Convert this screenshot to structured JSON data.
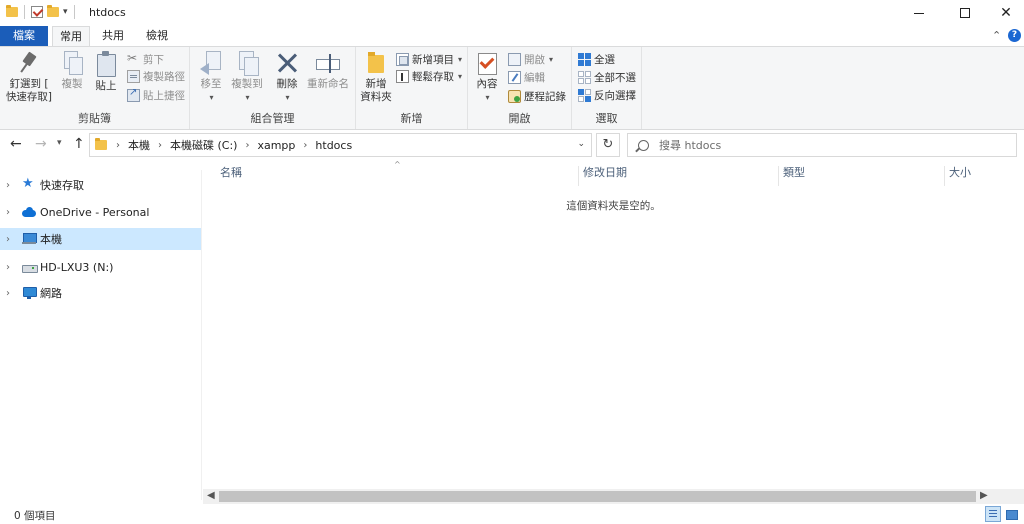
{
  "window": {
    "title": "htdocs"
  },
  "ribbon_tabs": [
    {
      "label": "檔案"
    },
    {
      "label": "常用"
    },
    {
      "label": "共用"
    },
    {
      "label": "檢視"
    }
  ],
  "ribbon": {
    "clipboard": {
      "group_label": "剪貼簿",
      "pin_quick_access_line1": "釘選到 [",
      "pin_quick_access_line2": "快速存取]",
      "copy": "複製",
      "paste": "貼上",
      "cut": "剪下",
      "copy_path": "複製路徑",
      "paste_shortcut": "貼上捷徑"
    },
    "organize": {
      "group_label": "組合管理",
      "move_to": "移至",
      "copy_to": "複製到",
      "delete": "刪除",
      "rename": "重新命名"
    },
    "new": {
      "group_label": "新增",
      "new_folder_line1": "新增",
      "new_folder_line2": "資料夾",
      "new_item": "新增項目",
      "easy_access": "輕鬆存取"
    },
    "open": {
      "group_label": "開啟",
      "properties": "內容",
      "open": "開啟",
      "edit": "編輯",
      "history": "歷程記錄"
    },
    "select": {
      "group_label": "選取",
      "select_all": "全選",
      "select_none": "全部不選",
      "invert_selection": "反向選擇"
    }
  },
  "address_bar": {
    "breadcrumbs": [
      "本機",
      "本機磁碟 (C:)",
      "xampp",
      "htdocs"
    ]
  },
  "search": {
    "placeholder": "搜尋 htdocs"
  },
  "nav_pane": {
    "items": [
      {
        "label": "快速存取",
        "icon": "star-icon",
        "selected": false
      },
      {
        "label": "OneDrive - Personal",
        "icon": "cloud-icon",
        "selected": false
      },
      {
        "label": "本機",
        "icon": "computer-icon",
        "selected": true
      },
      {
        "label": "HD-LXU3 (N:)",
        "icon": "drive-icon",
        "selected": false
      },
      {
        "label": "網路",
        "icon": "network-icon",
        "selected": false
      }
    ]
  },
  "file_list": {
    "columns": [
      "名稱",
      "修改日期",
      "類型",
      "大小"
    ],
    "empty_message": "這個資料夾是空的。"
  },
  "status_bar": {
    "item_count": "0 個項目"
  },
  "colors": {
    "file_tab": "#1b5db9",
    "selection": "#cce8ff",
    "ribbon_bg": "#f5f6f7"
  }
}
